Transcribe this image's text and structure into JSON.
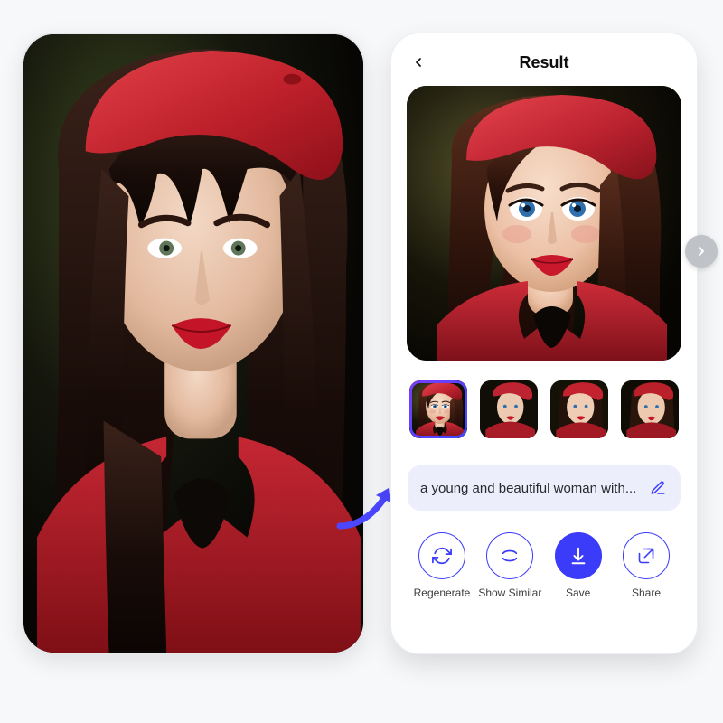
{
  "header": {
    "title": "Result"
  },
  "prompt": {
    "text": "a young and beautiful woman with..."
  },
  "actions": {
    "regenerate": "Regenerate",
    "similar": "Show Similar",
    "save": "Save",
    "share": "Share"
  },
  "thumb_count": 4,
  "selected_thumb": 0,
  "palette": {
    "accent": "#3b3bfa",
    "beret": "#c7252e",
    "lips": "#c41528",
    "dress": "#b01e27",
    "skin": "#eccdb9",
    "skin_shadow": "#d1a890",
    "hair": "#2a1510",
    "bg_dark": "#141309"
  }
}
